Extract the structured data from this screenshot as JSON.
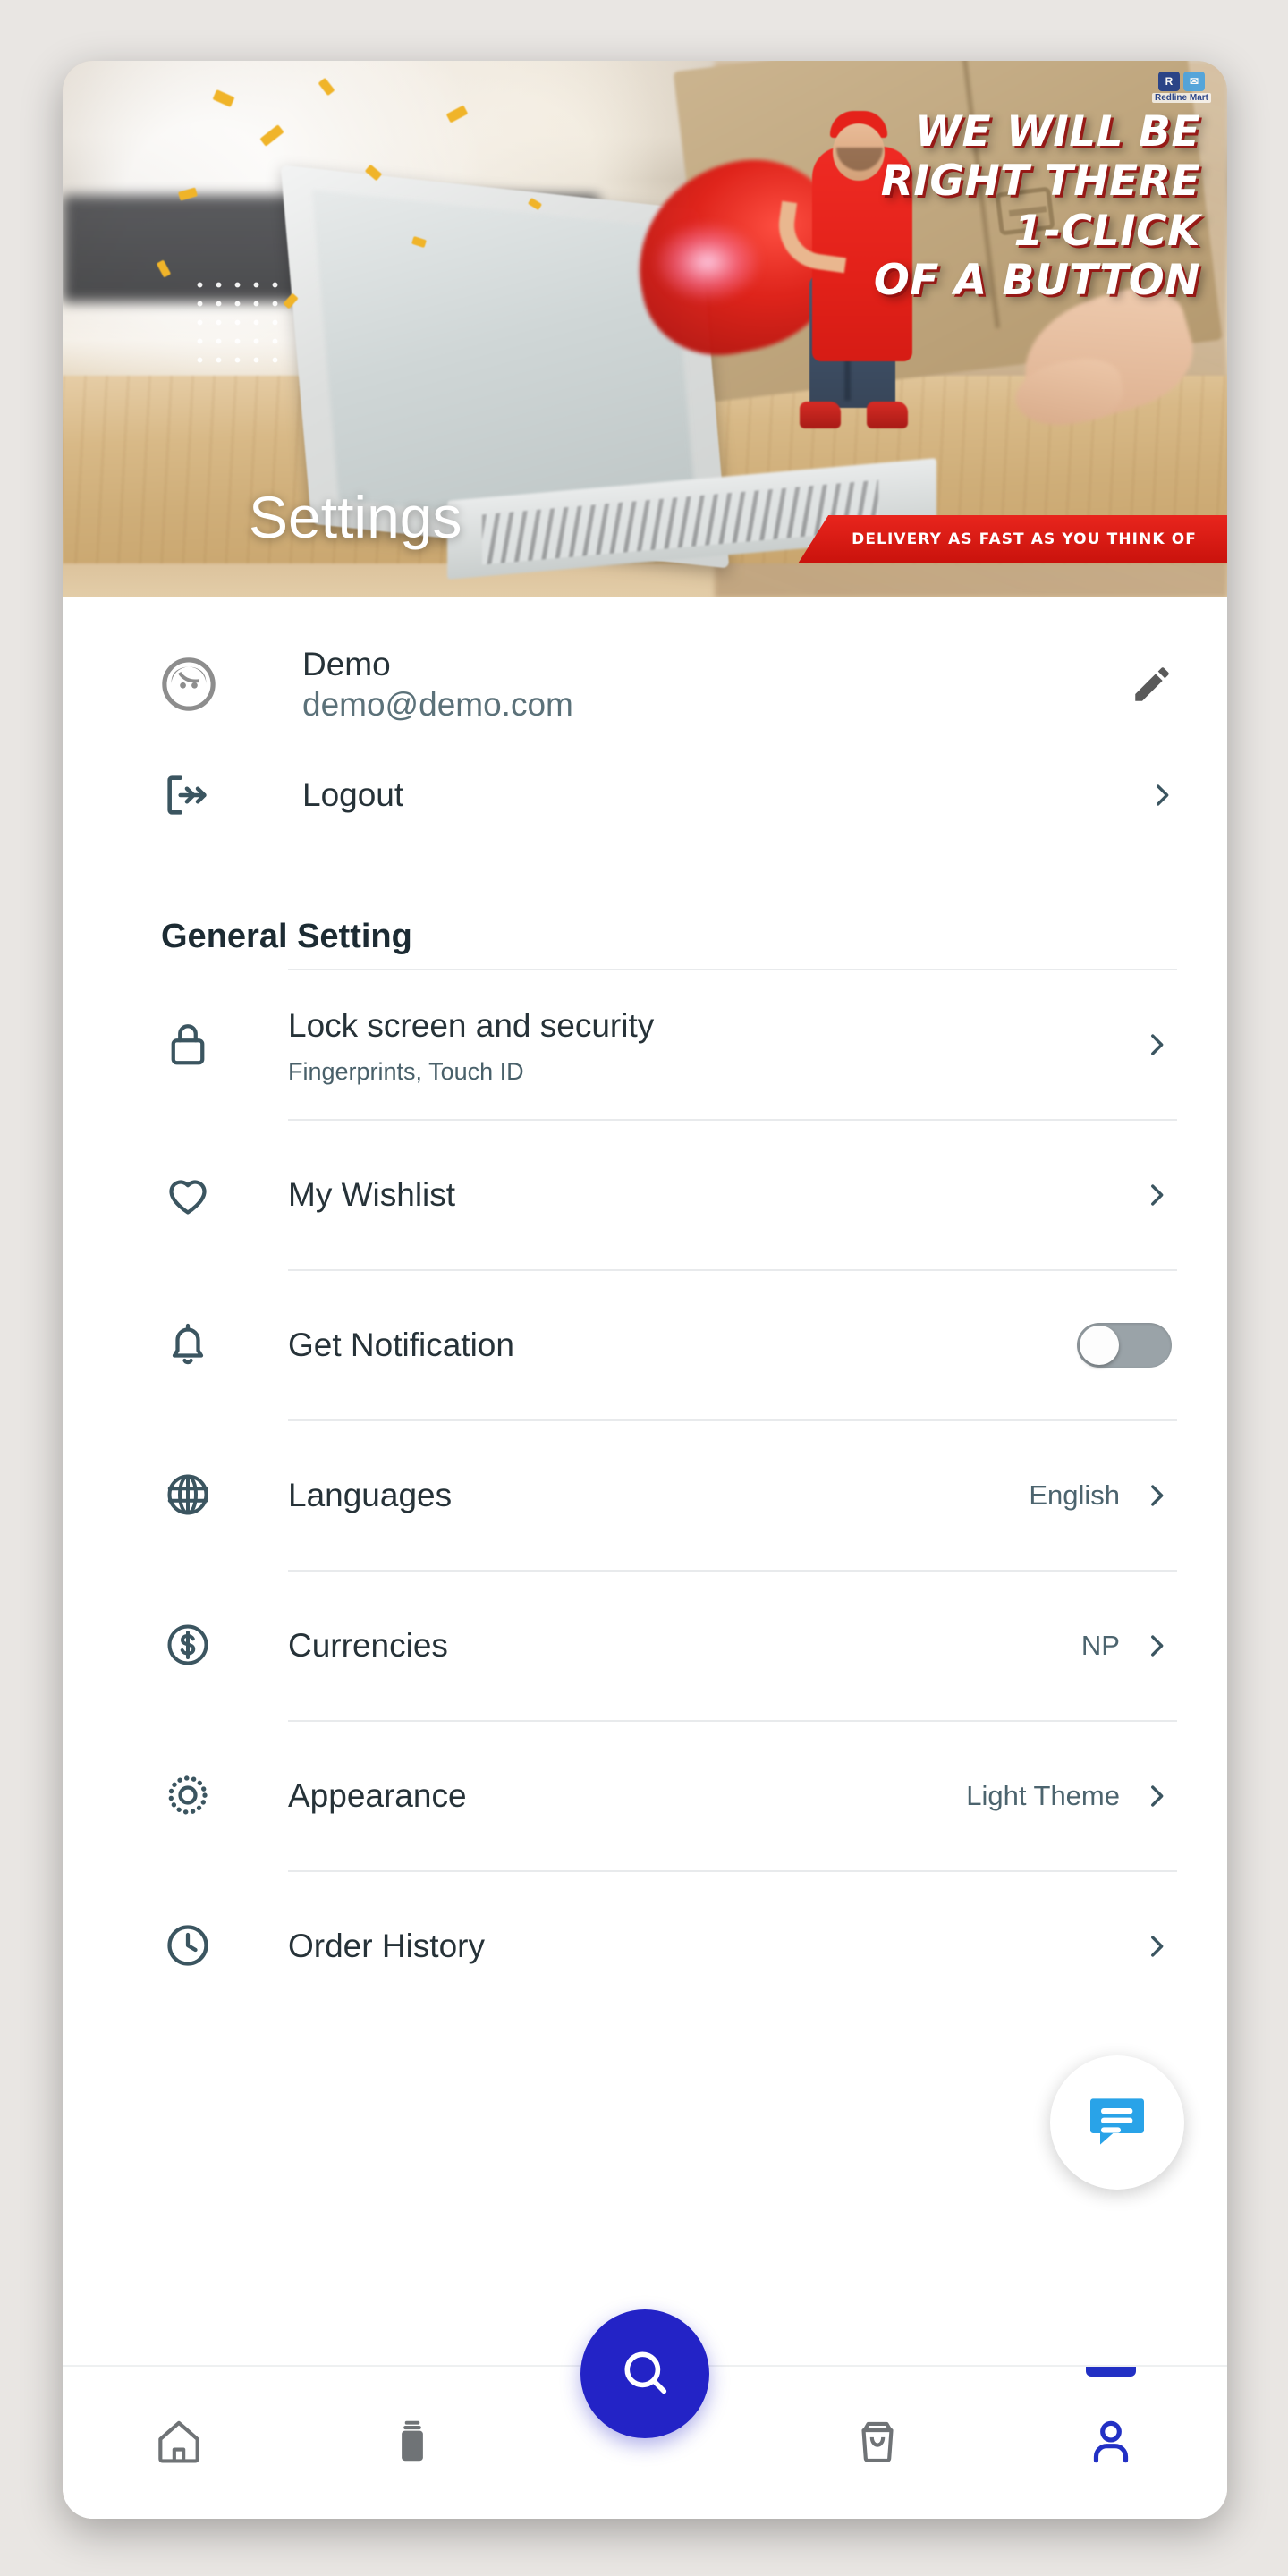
{
  "banner": {
    "page_title": "Settings",
    "headline_lines": [
      "WE WILL BE",
      "RIGHT THERE",
      "1-CLICK",
      "OF A BUTTON"
    ],
    "ribbon_text": "DELIVERY AS FAST AS YOU THINK OF",
    "brand_initial": "R",
    "brand_initial_alt": "✉",
    "brand_name": "Redline Mart"
  },
  "profile": {
    "name": "Demo",
    "email": "demo@demo.com",
    "avatar_icon": "user-avatar-icon",
    "edit_icon": "pencil-edit-icon"
  },
  "logout": {
    "label": "Logout",
    "icon": "logout-arrow-icon",
    "chevron_icon": "chevron-right-icon"
  },
  "general_section": {
    "title": "General Setting",
    "items": [
      {
        "id": "lock-screen-and-security",
        "title": "Lock screen and security",
        "subtitle": "Fingerprints, Touch ID",
        "icon": "lock-icon",
        "control": "chevron",
        "value": ""
      },
      {
        "id": "my-wishlist",
        "title": "My Wishlist",
        "subtitle": "",
        "icon": "heart-icon",
        "control": "chevron",
        "value": ""
      },
      {
        "id": "get-notification",
        "title": "Get Notification",
        "subtitle": "",
        "icon": "bell-icon",
        "control": "toggle",
        "value": "",
        "toggle_on": false
      },
      {
        "id": "languages",
        "title": "Languages",
        "subtitle": "",
        "icon": "globe-icon",
        "control": "value-chevron",
        "value": "English"
      },
      {
        "id": "currencies",
        "title": "Currencies",
        "subtitle": "",
        "icon": "dollar-circle-icon",
        "control": "value-chevron",
        "value": "NP"
      },
      {
        "id": "appearance",
        "title": "Appearance",
        "subtitle": "",
        "icon": "sun-brightness-icon",
        "control": "value-chevron",
        "value": "Light Theme"
      },
      {
        "id": "order-history",
        "title": "Order History",
        "subtitle": "",
        "icon": "clock-icon",
        "control": "chevron",
        "value": ""
      }
    ]
  },
  "chat_fab": {
    "icon": "chat-bubble-icon",
    "color": "#29a3e8"
  },
  "search_fab": {
    "icon": "search-icon",
    "color": "#2323c6"
  },
  "bottom_nav": {
    "active_color": "#2230c4",
    "inactive_color": "#6f7376",
    "items": [
      {
        "id": "home",
        "icon": "home-icon",
        "active": false
      },
      {
        "id": "categories",
        "icon": "box-stack-icon",
        "active": false
      },
      {
        "id": "cart",
        "icon": "shopping-bag-icon",
        "active": false
      },
      {
        "id": "account",
        "icon": "person-icon",
        "active": true
      }
    ]
  }
}
